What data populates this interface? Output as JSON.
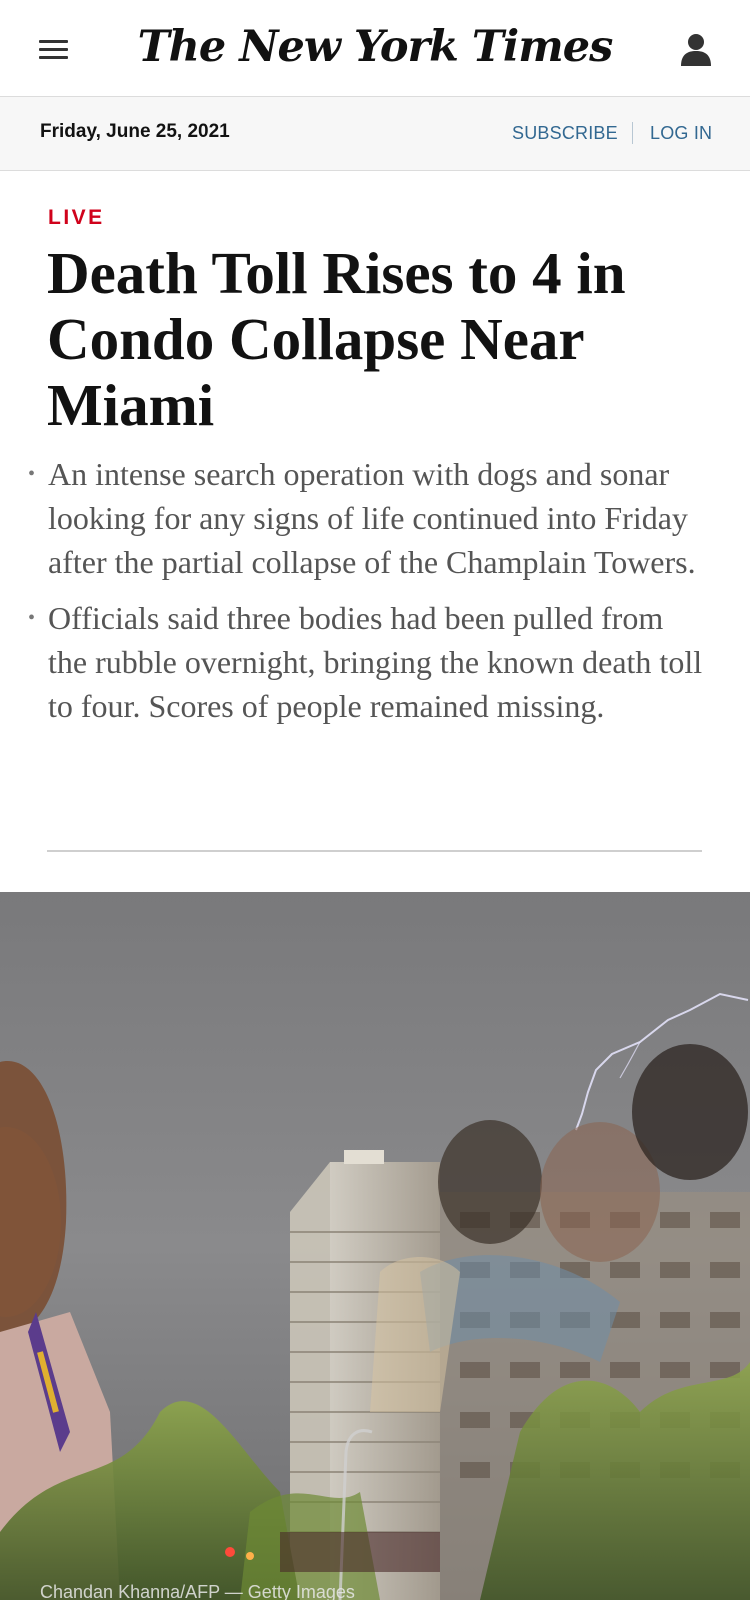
{
  "masthead": {
    "logo_text": "The New York Times",
    "menu_icon": "hamburger-menu-icon",
    "account_icon": "user-account-icon"
  },
  "subbar": {
    "date": "Friday, June 25, 2021",
    "subscribe_label": "SUBSCRIBE",
    "login_label": "LOG IN"
  },
  "article": {
    "live_label": "LIVE",
    "headline": "Death Toll Rises to 4 in Condo Collapse Near Miami",
    "summary": [
      "An intense search operation with dogs and sonar looking for any signs of life continued into Friday after the partial collapse of the Champlain Towers.",
      "Officials said three bodies had been pulled from the rubble overnight, bringing the known death toll to four. Scores of people remained missing."
    ],
    "bullet_glyph": "•"
  },
  "hero": {
    "credit": "Chandan Khanna/AFP — Getty Images"
  },
  "colors": {
    "live_red": "#d0021b",
    "link_blue": "#326891",
    "text_dark": "#121212",
    "summary_gray": "#555555"
  }
}
